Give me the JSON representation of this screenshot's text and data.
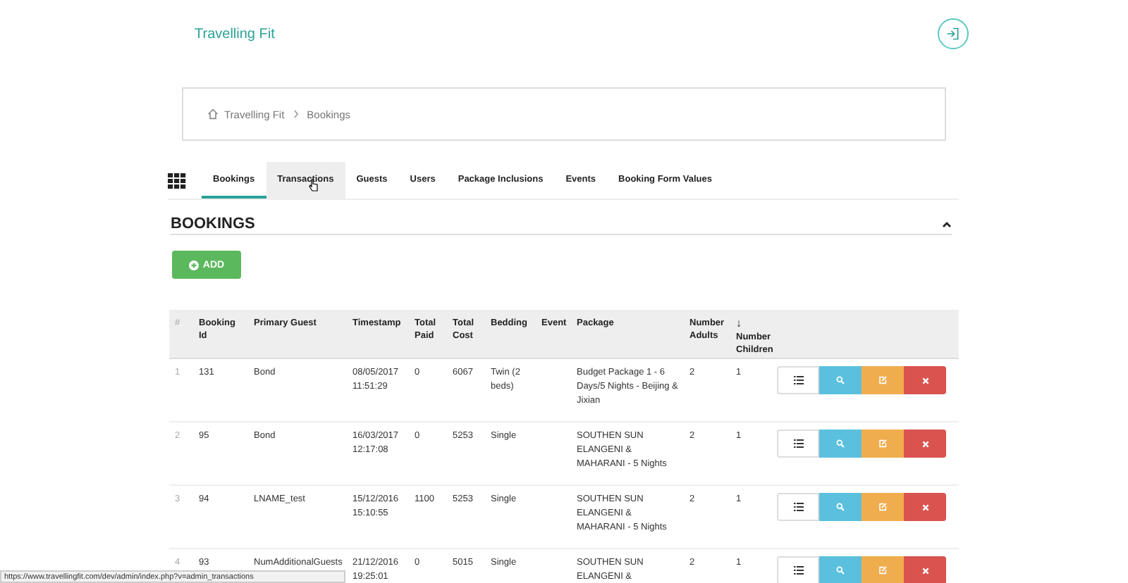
{
  "header": {
    "brand": "Travelling Fit"
  },
  "breadcrumb": [
    "Travelling Fit",
    "Bookings"
  ],
  "tabs": [
    {
      "label": "Bookings",
      "selected": true,
      "hovered": false
    },
    {
      "label": "Transactions",
      "selected": false,
      "hovered": true
    },
    {
      "label": "Guests",
      "selected": false,
      "hovered": false
    },
    {
      "label": "Users",
      "selected": false,
      "hovered": false
    },
    {
      "label": "Package Inclusions",
      "selected": false,
      "hovered": false
    },
    {
      "label": "Events",
      "selected": false,
      "hovered": false
    },
    {
      "label": "Booking Form Values",
      "selected": false,
      "hovered": false
    }
  ],
  "section": {
    "title": "BOOKINGS",
    "expanded": true
  },
  "add_button": "ADD",
  "table": {
    "columns": [
      {
        "label": "#",
        "sorted": false
      },
      {
        "label": "Booking Id",
        "sorted": false
      },
      {
        "label": "Primary Guest",
        "sorted": false
      },
      {
        "label": "Timestamp",
        "sorted": false
      },
      {
        "label": "Total Paid",
        "sorted": false
      },
      {
        "label": "Total Cost",
        "sorted": false
      },
      {
        "label": "Bedding",
        "sorted": false
      },
      {
        "label": "Event",
        "sorted": false
      },
      {
        "label": "Package",
        "sorted": false
      },
      {
        "label": "Number Adults",
        "sorted": false
      },
      {
        "label": "Number Children",
        "sorted": true,
        "sort_indicator": "↓"
      }
    ],
    "rows": [
      [
        "1",
        "131",
        "Bond",
        "08/05/2017 11:51:29",
        "0",
        "6067",
        "Twin (2 beds)",
        "",
        "Budget Package 1 - 6 Days/5 Nights - Beijing & Jixian",
        "2",
        "1"
      ],
      [
        "2",
        "95",
        "Bond",
        "16/03/2017 12:17:08",
        "0",
        "5253",
        "Single",
        "",
        "SOUTHEN SUN ELANGENI & MAHARANI - 5 Nights",
        "2",
        "1"
      ],
      [
        "3",
        "94",
        "LNAME_test",
        "15/12/2016 15:10:55",
        "1100",
        "5253",
        "Single",
        "",
        "SOUTHEN SUN ELANGENI & MAHARANI - 5 Nights",
        "2",
        "1"
      ],
      [
        "4",
        "93",
        "NumAdditionalGuests",
        "21/12/2016 19:25:01",
        "0",
        "5015",
        "Single",
        "",
        "SOUTHEN SUN ELANGENI &",
        "2",
        "1"
      ]
    ]
  },
  "status_bar": "https://www.travellingfit.com/dev/admin/index.php?v=admin_transactions"
}
